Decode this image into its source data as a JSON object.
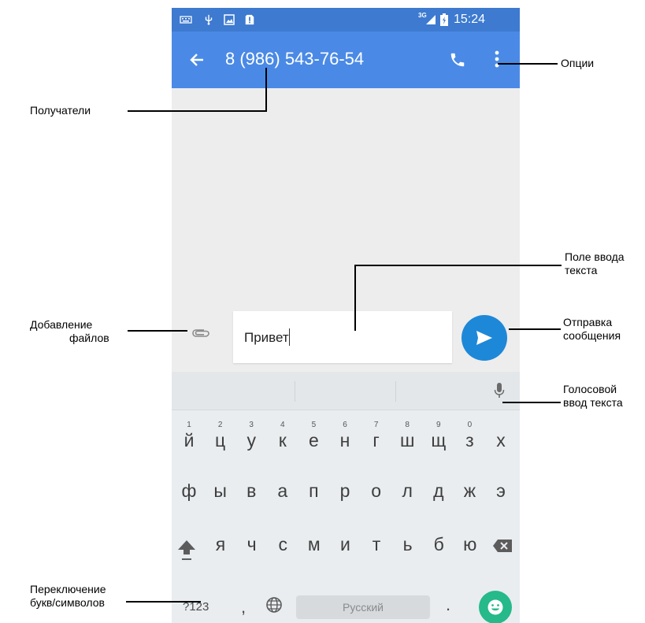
{
  "status_bar": {
    "network": "3G",
    "time": "15:24"
  },
  "app_bar": {
    "title": "8 (986) 543-76-54"
  },
  "composer": {
    "message_text": "Привет"
  },
  "keyboard": {
    "row1_hints": [
      "1",
      "2",
      "3",
      "4",
      "5",
      "6",
      "7",
      "8",
      "9",
      "0"
    ],
    "row1": [
      "й",
      "ц",
      "у",
      "к",
      "е",
      "н",
      "г",
      "ш",
      "щ",
      "з",
      "х"
    ],
    "row2": [
      "ф",
      "ы",
      "в",
      "а",
      "п",
      "р",
      "о",
      "л",
      "д",
      "ж",
      "э"
    ],
    "row3": [
      "я",
      "ч",
      "с",
      "м",
      "и",
      "т",
      "ь",
      "б",
      "ю"
    ],
    "symbols_label": "?123",
    "comma": ",",
    "space_label": "Русский",
    "period": "."
  },
  "annotations": {
    "options": "Опции",
    "recipients": "Получатели",
    "input_field": [
      "Поле ввода",
      "текста"
    ],
    "add_files": [
      "Добавление",
      "файлов"
    ],
    "send": [
      "Отправка",
      "сообщения"
    ],
    "voice": [
      "Голосовой",
      "ввод текста"
    ],
    "switch": [
      "Переключение",
      "букв/символов"
    ]
  },
  "colors": {
    "app_bar": "#4a8ae6",
    "status_bar": "#3d7ad0",
    "send_button": "#1e88d8",
    "emoji_button": "#26b98a"
  }
}
